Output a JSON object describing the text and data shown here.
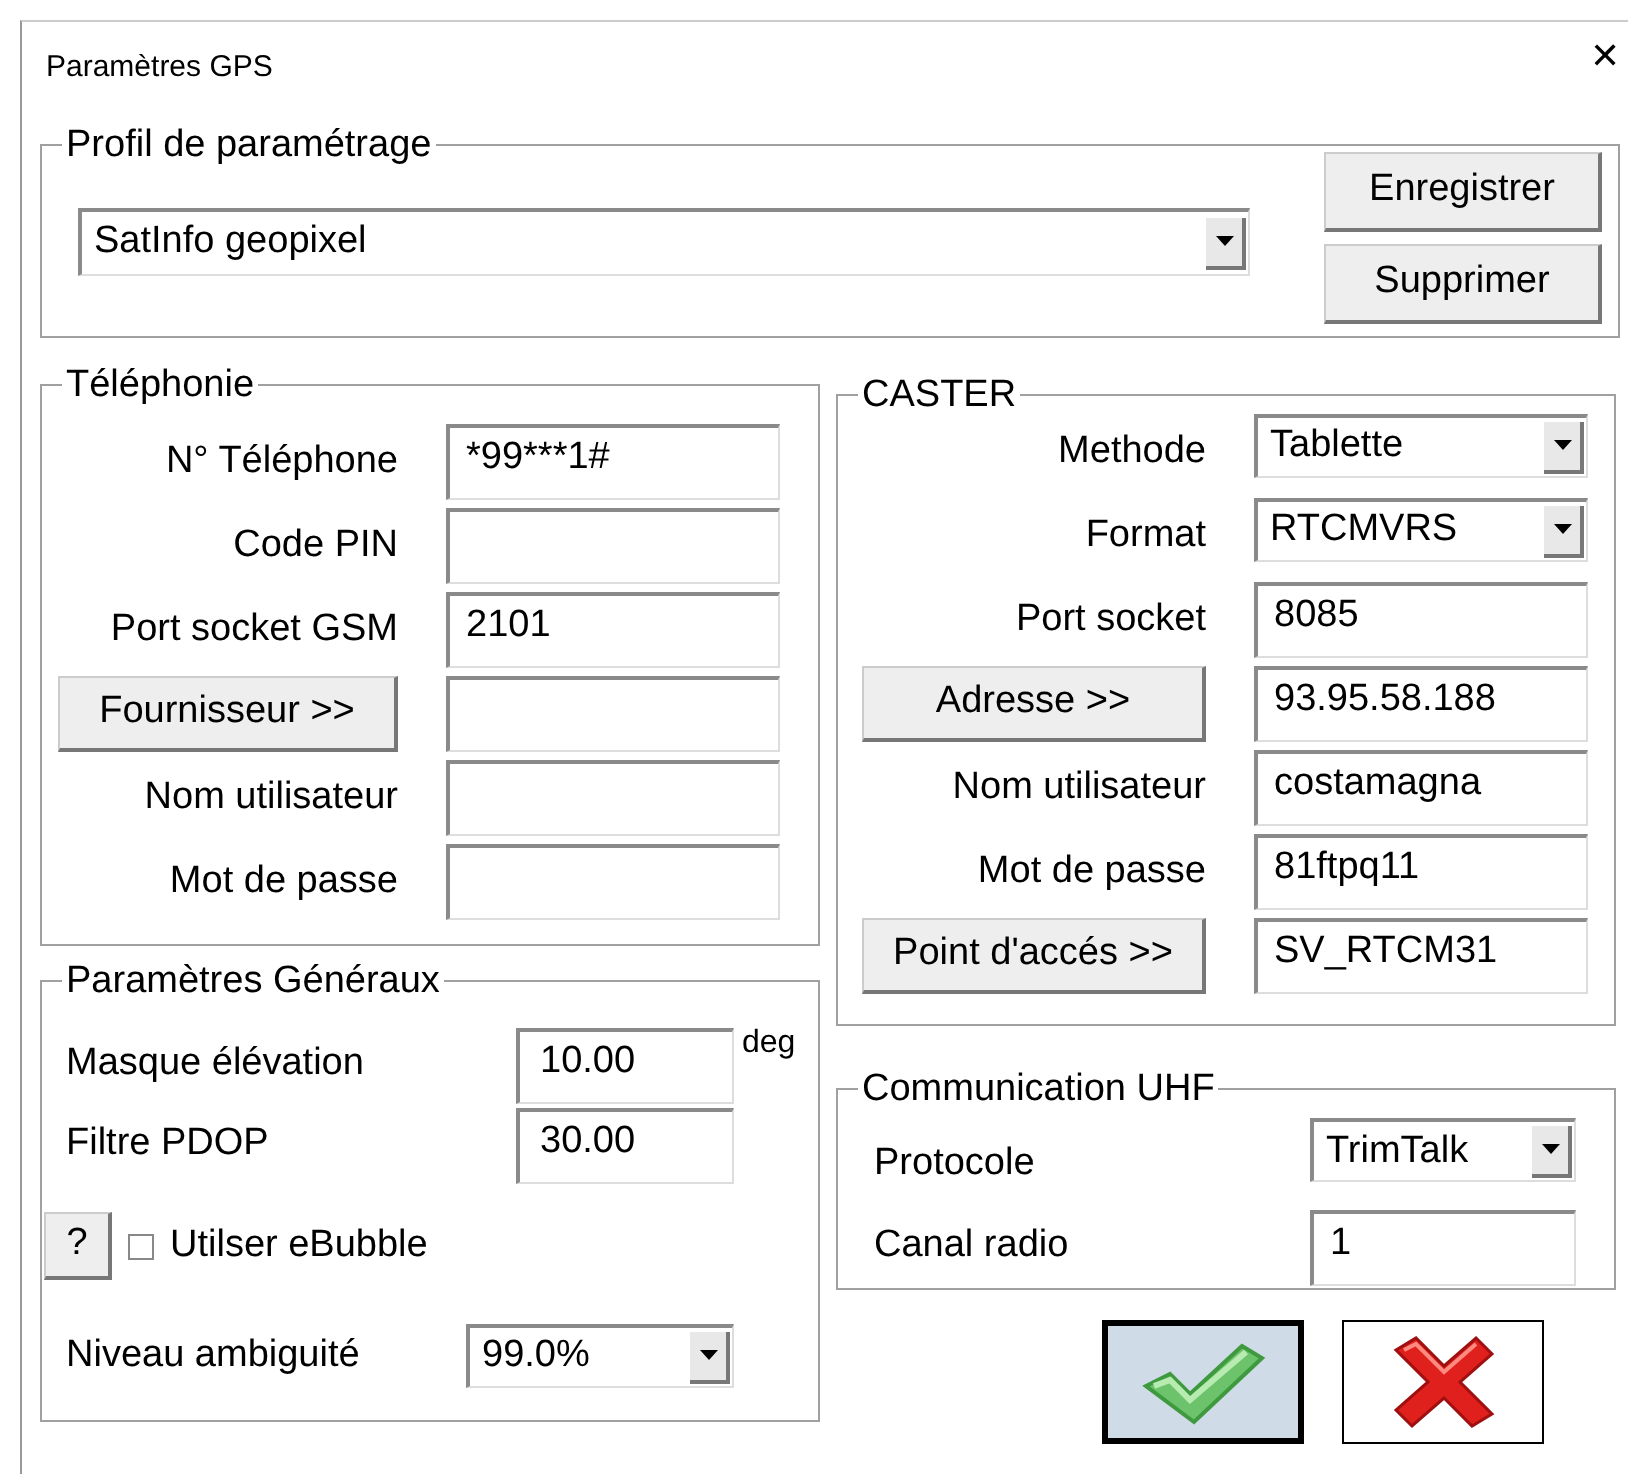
{
  "window": {
    "title": "Paramètres GPS",
    "close": "✕"
  },
  "profile": {
    "legend": "Profil de paramétrage",
    "value": "SatInfo geopixel",
    "buttons": [
      "Enregistrer",
      "Supprimer"
    ]
  },
  "telephony": {
    "legend": "Téléphonie",
    "rows": [
      {
        "kind": "field",
        "label": "N° Téléphone",
        "value": "*99***1#"
      },
      {
        "kind": "field",
        "label": "Code PIN"
      },
      {
        "kind": "field",
        "label": "Port socket GSM",
        "value": "2101"
      },
      {
        "kind": "button",
        "label": "Fournisseur >>"
      },
      {
        "kind": "field",
        "label": "Nom utilisateur"
      },
      {
        "kind": "field",
        "label": "Mot de passe"
      }
    ]
  },
  "caster": {
    "legend": "CASTER",
    "rows": [
      {
        "kind": "select",
        "label": "Methode",
        "value": "Tablette"
      },
      {
        "kind": "select",
        "label": "Format",
        "value": "RTCMVRS"
      },
      {
        "kind": "field",
        "label": "Port socket",
        "value": "8085"
      },
      {
        "kind": "button",
        "label": "Adresse >>",
        "value": "93.95.58.188"
      },
      {
        "kind": "field",
        "label": "Nom utilisateur",
        "value": "costamagna"
      },
      {
        "kind": "field",
        "label": "Mot de passe",
        "value": "81ftpq11"
      },
      {
        "kind": "button",
        "label": "Point d'accés >>",
        "value": "SV_RTCM31"
      }
    ]
  },
  "general": {
    "legend": "Paramètres Généraux",
    "mask": {
      "label": "Masque élévation",
      "value": "10.00",
      "unit": "deg"
    },
    "pdop": {
      "label": "Filtre PDOP",
      "value": "30.00"
    },
    "help": "?",
    "ebubble": {
      "label": "Utilser eBubble",
      "checked": false
    },
    "ambiguity": {
      "label": "Niveau ambiguité",
      "value": "99.0%"
    }
  },
  "uhf": {
    "legend": "Communication UHF",
    "rows": [
      {
        "kind": "select",
        "label": "Protocole",
        "value": "TrimTalk"
      },
      {
        "kind": "field",
        "label": "Canal radio",
        "value": "1"
      }
    ]
  },
  "dialog_buttons": [
    {
      "kind": "ok",
      "focused": true
    },
    {
      "kind": "cancel",
      "focused": false
    }
  ]
}
